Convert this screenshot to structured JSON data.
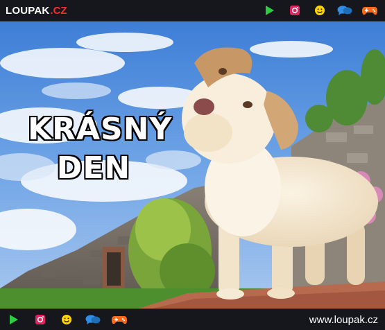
{
  "header": {
    "logo_main": "LOUPAK",
    "logo_tld": ".CZ"
  },
  "caption": {
    "line1": "KRÁSNÝ",
    "line2": "DEN"
  },
  "footer": {
    "site": "www.loupak.cz"
  },
  "icons": {
    "play": "play-icon",
    "instagram": "instagram-icon",
    "smiley": "smiley-icon",
    "chat": "chat-icon",
    "gamepad": "gamepad-icon"
  },
  "colors": {
    "bar_bg": "#15171c",
    "play": "#2ecc40",
    "instagram": "#e0245e",
    "smiley": "#ffd400",
    "chat": "#2f8fe6",
    "gamepad": "#ff6a1a",
    "logo_tld": "#ff2c2c"
  }
}
